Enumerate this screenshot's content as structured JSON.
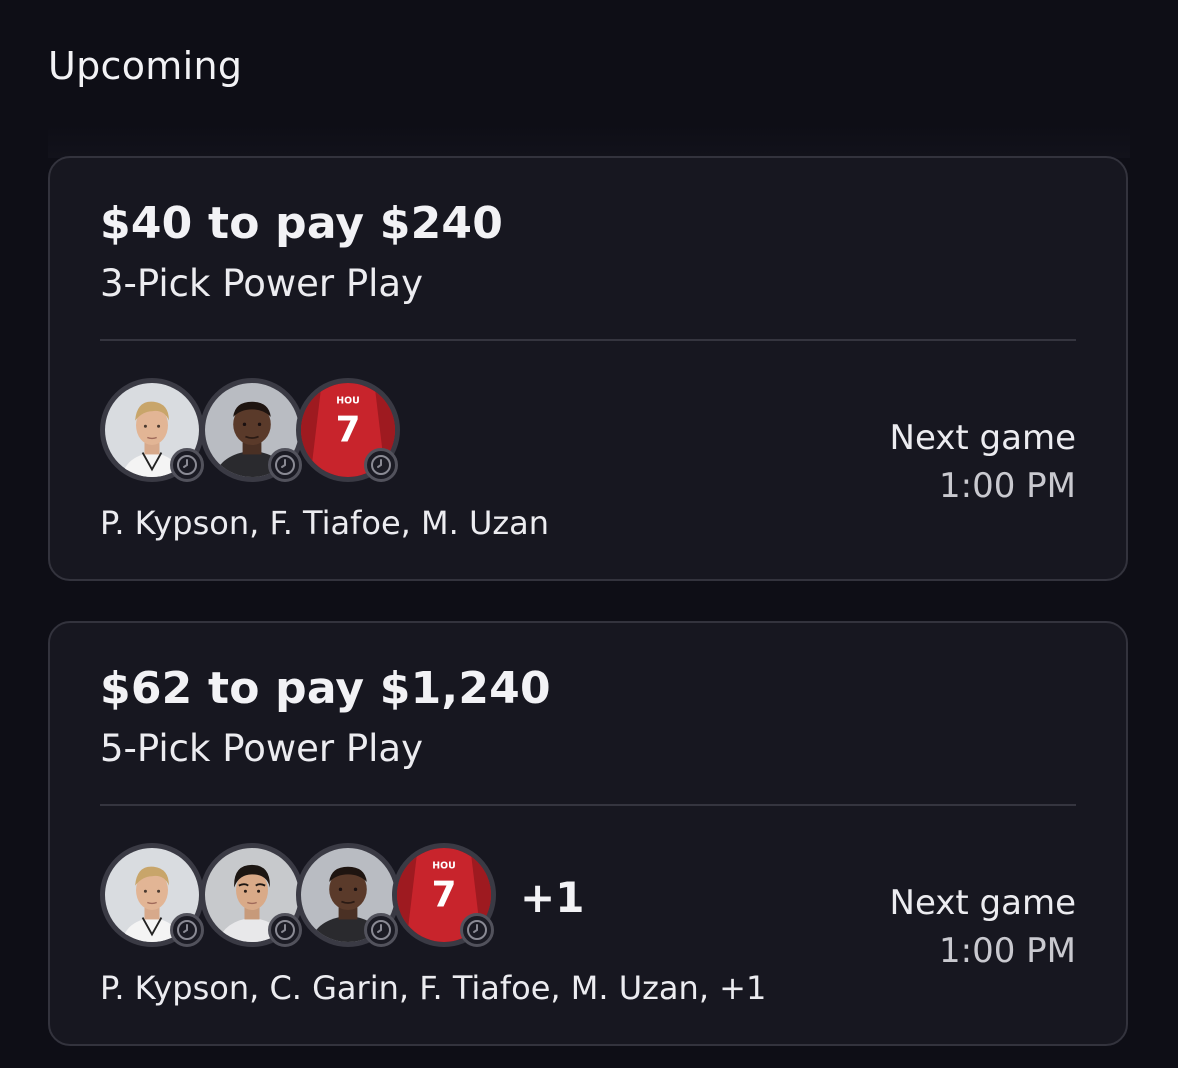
{
  "section": {
    "title": "Upcoming"
  },
  "entries": [
    {
      "payout": "$40 to pay $240",
      "play_type": "3-Pick Power Play",
      "players": [
        "P. Kypson",
        "F. Tiafoe",
        "M. Uzan"
      ],
      "players_text": "P. Kypson, F. Tiafoe, M. Uzan",
      "more_label": "",
      "next_game_label": "Next game",
      "next_game_time": "1:00 PM"
    },
    {
      "payout": "$62 to pay $1,240",
      "play_type": "5-Pick Power Play",
      "players": [
        "P. Kypson",
        "C. Garin",
        "F. Tiafoe",
        "M. Uzan"
      ],
      "players_text": "P. Kypson, C. Garin, F. Tiafoe, M. Uzan, +1",
      "more_label": "+1",
      "next_game_label": "Next game",
      "next_game_time": "1:00 PM"
    }
  ],
  "jersey": {
    "team": "HOU",
    "number": "7",
    "color": "#c8242c"
  },
  "colors": {
    "background": "#0e0e16",
    "card": "#171720",
    "card_border": "#33333d",
    "text": "#f2f2f5"
  },
  "icons": {
    "status": "clock-icon"
  }
}
